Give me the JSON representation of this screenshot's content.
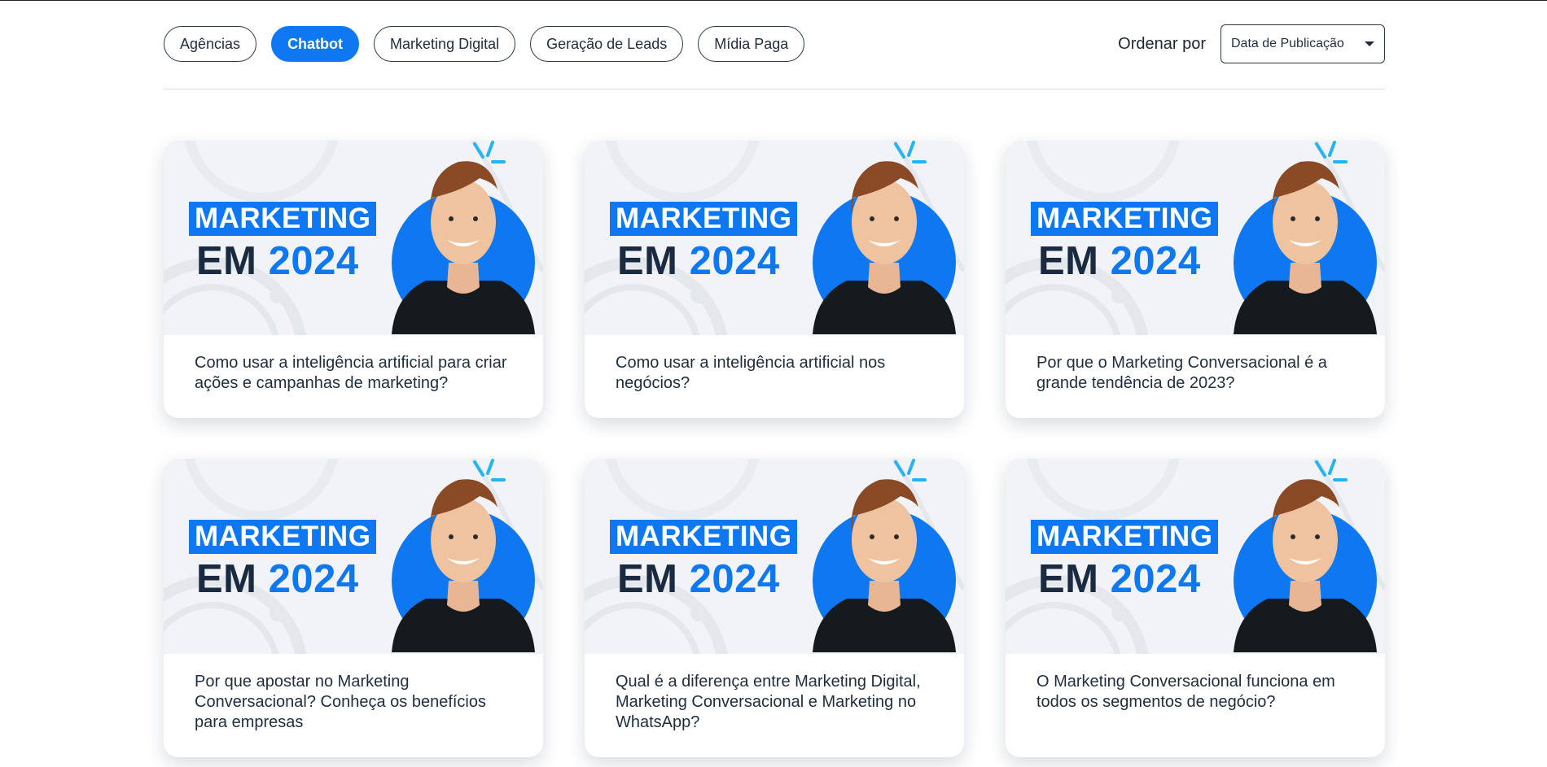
{
  "filters": [
    {
      "label": "Agências",
      "active": false
    },
    {
      "label": "Chatbot",
      "active": true
    },
    {
      "label": "Marketing Digital",
      "active": false
    },
    {
      "label": "Geração de Leads",
      "active": false
    },
    {
      "label": "Mídia Paga",
      "active": false
    }
  ],
  "sort": {
    "label": "Ordenar por",
    "selected": "Data de Publicação"
  },
  "thumbnail": {
    "line1": "MARKETING",
    "line2_a": "EM",
    "line2_b": "2024"
  },
  "colors": {
    "accent": "#0d78f2",
    "text": "#1f2d3d",
    "thumb_bg": "#f1f3f6"
  },
  "cards": [
    {
      "title": "Como usar a inteligência artificial para criar ações e campanhas de marketing?"
    },
    {
      "title": "Como usar a inteligência artificial nos negócios?"
    },
    {
      "title": "Por que o Marketing Conversacional é a grande tendência de 2023?"
    },
    {
      "title": "Por que apostar no Marketing Conversacional? Conheça os benefícios para empresas"
    },
    {
      "title": "Qual é a diferença entre Marketing Digital, Marketing Conversacional e Marketing no WhatsApp?"
    },
    {
      "title": "O Marketing Conversacional funciona em todos os segmentos de negócio?"
    }
  ]
}
